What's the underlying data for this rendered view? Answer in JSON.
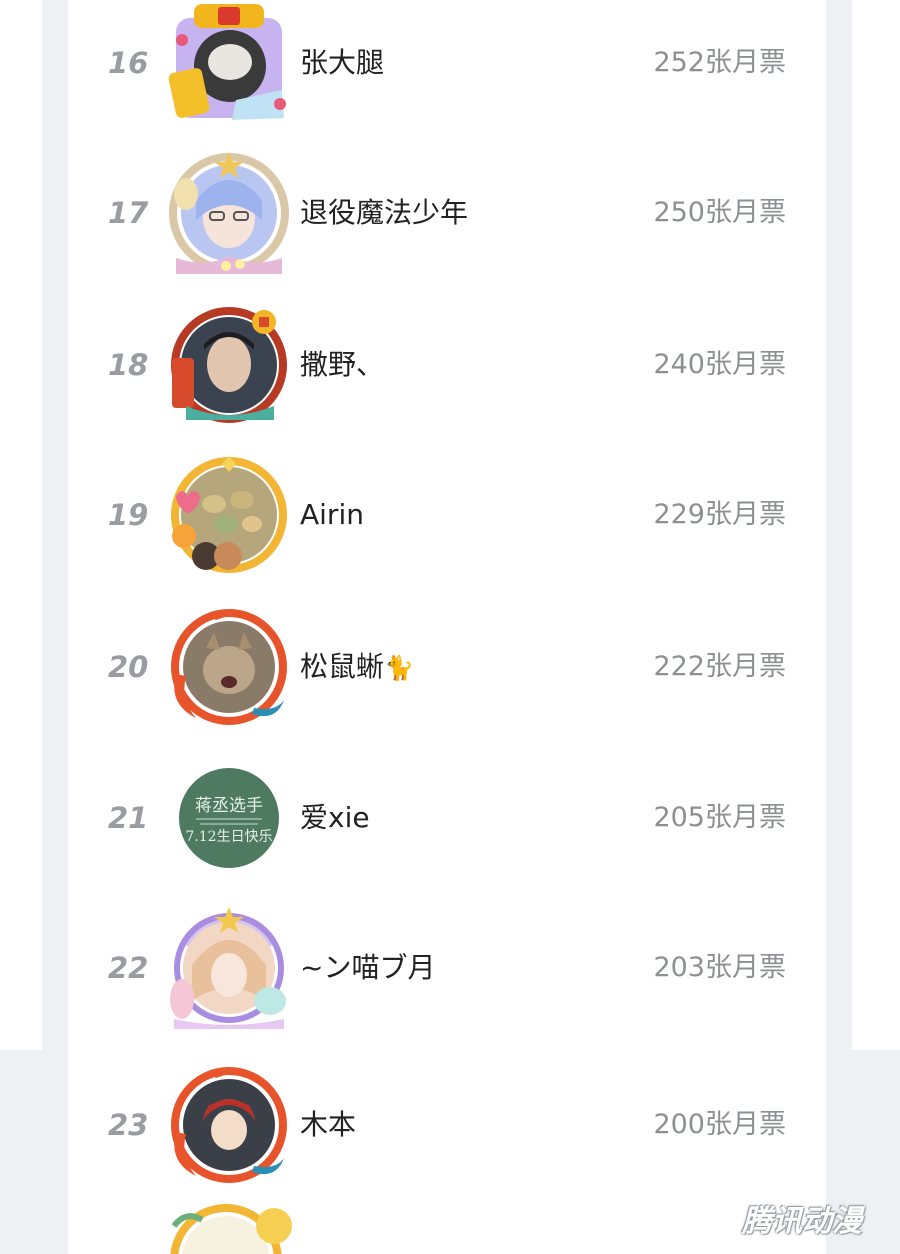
{
  "ranking": {
    "rows": [
      {
        "rank": "16",
        "name": "张大腿",
        "votes": "252张月票"
      },
      {
        "rank": "17",
        "name": "退役魔法少年",
        "votes": "250张月票"
      },
      {
        "rank": "18",
        "name": "撒野、",
        "votes": "240张月票"
      },
      {
        "rank": "19",
        "name": "Airin",
        "votes": "229张月票"
      },
      {
        "rank": "20",
        "name": "松鼠蜥",
        "emoji": "🐈",
        "votes": "222张月票"
      },
      {
        "rank": "21",
        "name": "爱xie",
        "votes": "205张月票"
      },
      {
        "rank": "22",
        "name": "~ン喵ブ月",
        "votes": "203张月票"
      },
      {
        "rank": "23",
        "name": "木本",
        "votes": "200张月票"
      }
    ],
    "avatar_21_text": {
      "line1": "蒋丞选手",
      "line2": "7.12生日快乐"
    }
  },
  "watermark": "腾讯动漫"
}
